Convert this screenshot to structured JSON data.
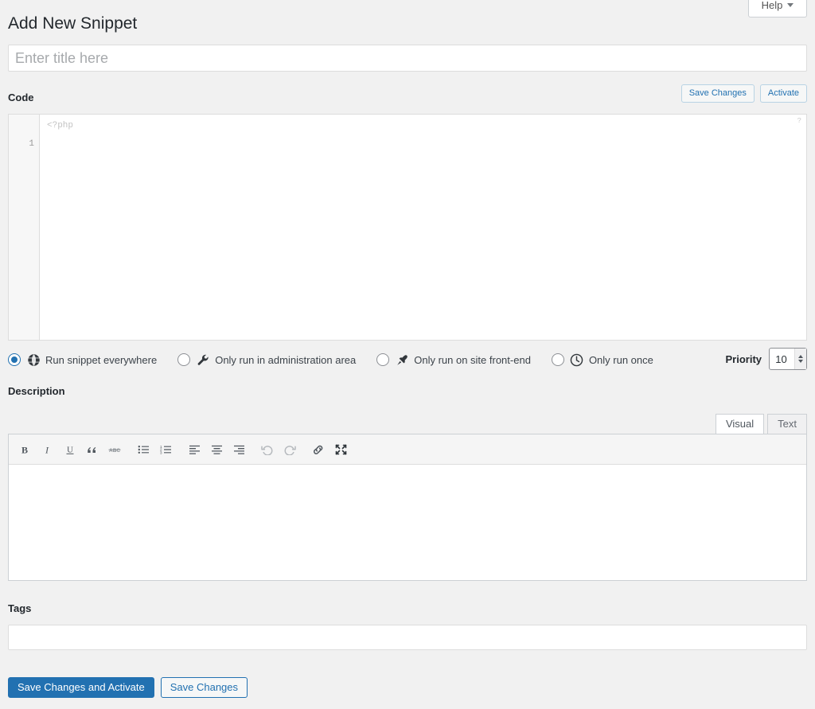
{
  "header": {
    "page_title": "Add New Snippet",
    "help_button": "Help"
  },
  "title_field": {
    "placeholder": "Enter title here",
    "value": ""
  },
  "code_section": {
    "label": "Code",
    "save_changes_label": "Save Changes",
    "activate_label": "Activate",
    "line_number": "1",
    "placeholder": "<?php",
    "help_icon_glyph": "?"
  },
  "scope": {
    "options": [
      {
        "label": "Run snippet everywhere",
        "icon": "globe-icon",
        "selected": true
      },
      {
        "label": "Only run in administration area",
        "icon": "wrench-icon",
        "selected": false
      },
      {
        "label": "Only run on site front-end",
        "icon": "pin-icon",
        "selected": false
      },
      {
        "label": "Only run once",
        "icon": "clock-icon",
        "selected": false
      }
    ]
  },
  "priority": {
    "label": "Priority",
    "value": "10"
  },
  "description": {
    "label": "Description",
    "tabs": [
      {
        "label": "Visual",
        "active": true
      },
      {
        "label": "Text",
        "active": false
      }
    ],
    "toolbar": [
      {
        "name": "bold-icon",
        "title": "Bold"
      },
      {
        "name": "italic-icon",
        "title": "Italic"
      },
      {
        "name": "underline-icon",
        "title": "Underline"
      },
      {
        "name": "blockquote-icon",
        "title": "Blockquote"
      },
      {
        "name": "strikethrough-icon",
        "title": "Strikethrough"
      },
      {
        "name": "bulleted-list-icon",
        "title": "Bulleted list"
      },
      {
        "name": "numbered-list-icon",
        "title": "Numbered list"
      },
      {
        "name": "align-left-icon",
        "title": "Align left"
      },
      {
        "name": "align-center-icon",
        "title": "Align center"
      },
      {
        "name": "align-right-icon",
        "title": "Align right"
      },
      {
        "name": "undo-icon",
        "title": "Undo"
      },
      {
        "name": "redo-icon",
        "title": "Redo"
      },
      {
        "name": "link-icon",
        "title": "Insert link"
      },
      {
        "name": "fullscreen-icon",
        "title": "Fullscreen"
      }
    ],
    "content": ""
  },
  "tags": {
    "label": "Tags",
    "value": "",
    "placeholder": ""
  },
  "footer": {
    "save_and_activate_label": "Save Changes and Activate",
    "save_label": "Save Changes"
  },
  "colors": {
    "accent": "#2271b1",
    "page_bg": "#f1f1f1",
    "border": "#ddd",
    "text": "#23282d"
  }
}
